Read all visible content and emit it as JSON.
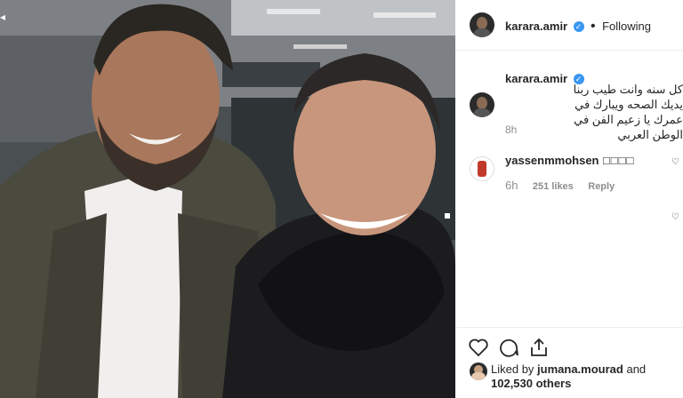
{
  "post": {
    "author": "karara.amir",
    "follow_status": "Following",
    "separator": "•",
    "caption": "كل سنه وانت طيب ربنا يديك الصحه ويبارك في عمرك يا زعيم الفن في الوطن العربي",
    "caption_age": "8h"
  },
  "comments": [
    {
      "username": "yassenmmohsen",
      "text": "□□□□",
      "age": "6h",
      "likes": "251 likes",
      "reply_label": "Reply"
    }
  ],
  "likes": {
    "prefix": "Liked by",
    "user": "jumana.mourad",
    "and": "and",
    "count": "102,530 others"
  },
  "icons": {
    "verified": "verified-badge-icon",
    "heart": "heart-icon",
    "comment": "comment-icon",
    "share": "share-icon"
  },
  "colors": {
    "verified": "#3897f0",
    "meta": "#8e8e8e",
    "text": "#262626"
  }
}
